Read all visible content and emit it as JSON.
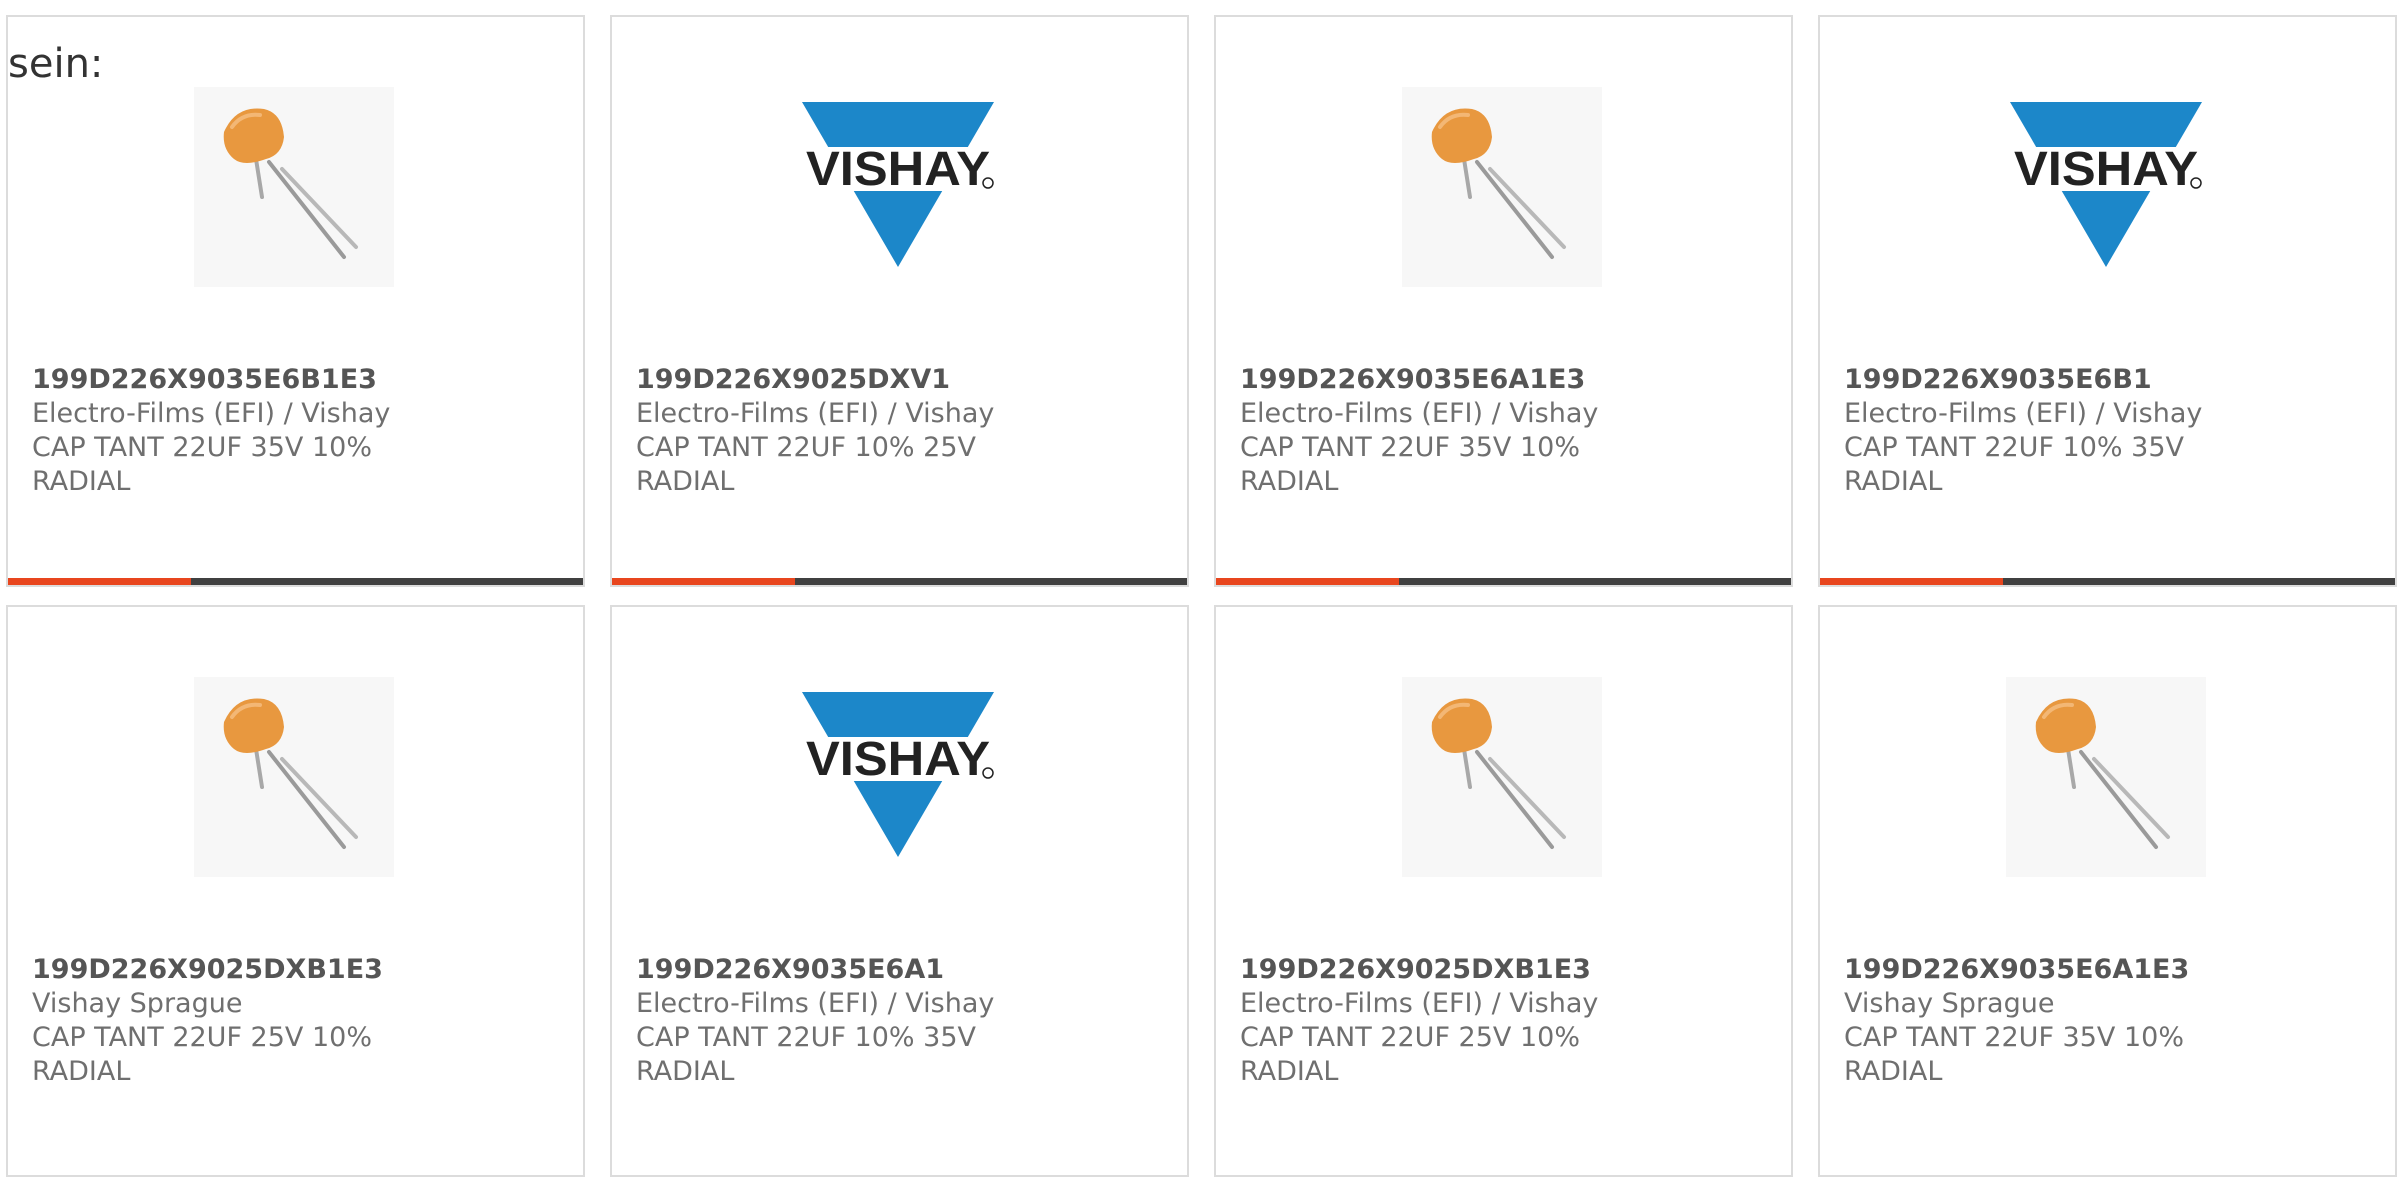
{
  "intro_text": "sein:",
  "colors": {
    "accent": "#e8461e",
    "bar": "#404040",
    "vishay_blue": "#1c87c9",
    "capacitor": "#e8983f"
  },
  "products": [
    {
      "part_number": "199D226X9035E6B1E3",
      "manufacturer": "Electro-Films (EFI) / Vishay",
      "description_line1": "CAP TANT 22UF 35V 10%",
      "description_line2": "RADIAL",
      "image": "capacitor-photo"
    },
    {
      "part_number": "199D226X9025DXV1",
      "manufacturer": "Electro-Films (EFI) / Vishay",
      "description_line1": "CAP TANT 22UF 10% 25V",
      "description_line2": "RADIAL",
      "image": "vishay-logo"
    },
    {
      "part_number": "199D226X9035E6A1E3",
      "manufacturer": "Electro-Films (EFI) / Vishay",
      "description_line1": "CAP TANT 22UF 35V 10%",
      "description_line2": "RADIAL",
      "image": "capacitor-photo"
    },
    {
      "part_number": "199D226X9035E6B1",
      "manufacturer": "Electro-Films (EFI) / Vishay",
      "description_line1": "CAP TANT 22UF 10% 35V",
      "description_line2": "RADIAL",
      "image": "vishay-logo"
    },
    {
      "part_number": "199D226X9025DXB1E3",
      "manufacturer": "Vishay Sprague",
      "description_line1": "CAP TANT 22UF 25V 10%",
      "description_line2": "RADIAL",
      "image": "capacitor-photo"
    },
    {
      "part_number": "199D226X9035E6A1",
      "manufacturer": "Electro-Films (EFI) / Vishay",
      "description_line1": "CAP TANT 22UF 10% 35V",
      "description_line2": "RADIAL",
      "image": "vishay-logo"
    },
    {
      "part_number": "199D226X9025DXB1E3",
      "manufacturer": "Electro-Films (EFI) / Vishay",
      "description_line1": "CAP TANT 22UF 25V 10%",
      "description_line2": "RADIAL",
      "image": "capacitor-photo"
    },
    {
      "part_number": "199D226X9035E6A1E3",
      "manufacturer": "Vishay Sprague",
      "description_line1": "CAP TANT 22UF 35V 10%",
      "description_line2": "RADIAL",
      "image": "capacitor-photo"
    }
  ]
}
